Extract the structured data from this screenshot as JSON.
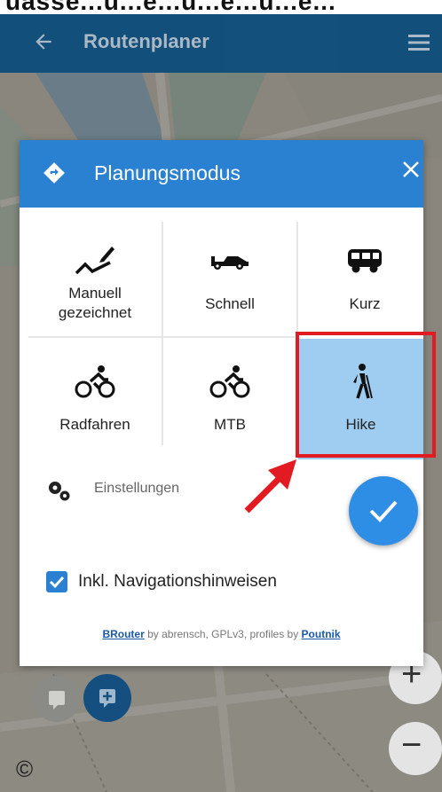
{
  "app_bar": {
    "title": "Routenplaner",
    "back_icon": "arrow-left-icon",
    "menu_icon": "hamburger-menu-icon",
    "color": "#0b4a79"
  },
  "dialog": {
    "title": "Planungsmodus",
    "header_color": "#2a80d1",
    "modes": [
      {
        "label": "Manuell\ngezeichnet",
        "icon": "freehand-line-icon",
        "selected": false
      },
      {
        "label": "Schnell",
        "icon": "race-car-icon",
        "selected": false
      },
      {
        "label": "Kurz",
        "icon": "van-icon",
        "selected": false
      },
      {
        "label": "Radfahren",
        "icon": "cyclist-icon",
        "selected": false
      },
      {
        "label": "MTB",
        "icon": "mountain-biker-icon",
        "selected": false
      },
      {
        "label": "Hike",
        "icon": "hiker-icon",
        "selected": true
      }
    ],
    "settings_label": "Einstellungen",
    "checkbox": {
      "label": "Inkl. Navigationshinweisen",
      "checked": true
    },
    "credits": {
      "link1": "BRouter",
      "mid": " by abrensch, GPLv3, profiles by ",
      "link2": "Poutnik"
    }
  },
  "map_controls": {
    "zoom_in": "+",
    "zoom_out": "−",
    "copyright": "©"
  },
  "highlight_color": "#e21a22"
}
